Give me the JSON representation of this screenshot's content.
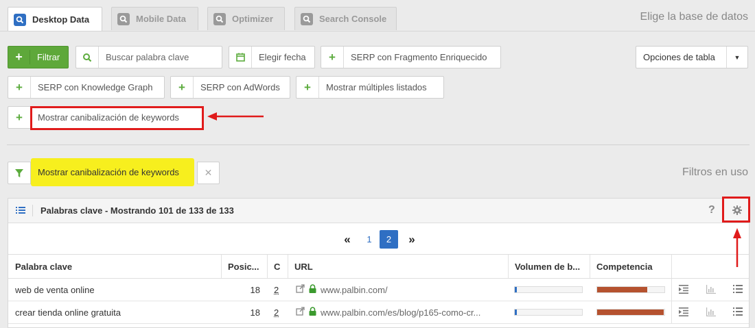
{
  "tabs": [
    {
      "label": "Desktop Data",
      "active": true
    },
    {
      "label": "Mobile Data",
      "active": false
    },
    {
      "label": "Optimizer",
      "active": false
    },
    {
      "label": "Search Console",
      "active": false
    }
  ],
  "db_hint": "Elige la base de datos",
  "toolbar": {
    "filtrar": "Filtrar",
    "search_placeholder": "Buscar palabra clave",
    "fecha": "Elegir fecha",
    "serp_fragmento": "SERP con Fragmento Enriquecido",
    "opciones": "Opciones de tabla",
    "serp_knowledge": "SERP con Knowledge Graph",
    "serp_adwords": "SERP con AdWords",
    "multiples": "Mostrar múltiples listados",
    "canibalizacion": "Mostrar canibalización de keywords"
  },
  "active_filter": {
    "label": "Mostrar canibalización de keywords"
  },
  "filtros_en_uso": "Filtros en uso",
  "panel": {
    "title": "Palabras clave - Mostrando 101 de 133 de 133",
    "help": "?",
    "pagination": {
      "prev": "«",
      "pages": [
        "1",
        "2"
      ],
      "current": "2",
      "next": "»"
    },
    "columns": [
      "Palabra clave",
      "Posic...",
      "C",
      "URL",
      "Volumen de b...",
      "Competencia"
    ],
    "rows": [
      {
        "keyword": "web de venta online",
        "pos": "18",
        "c": "2",
        "url_domain": "www.palbin.com",
        "url_path": "/",
        "volume": 0.03,
        "competition": 0.74
      },
      {
        "keyword": "crear tienda online gratuita",
        "pos": "18",
        "c": "2",
        "url_domain": "www.palbin.com",
        "url_path": "/es/blog/p165-como-cr...",
        "volume": 0.03,
        "competition": 0.99
      }
    ]
  },
  "colors": {
    "accent_blue": "#2f6fc3",
    "green": "#5ea83a",
    "red": "#e01b1b",
    "highlight": "#f7ef1e",
    "competition": "#b5522f",
    "volume": "#2f6fc3"
  }
}
